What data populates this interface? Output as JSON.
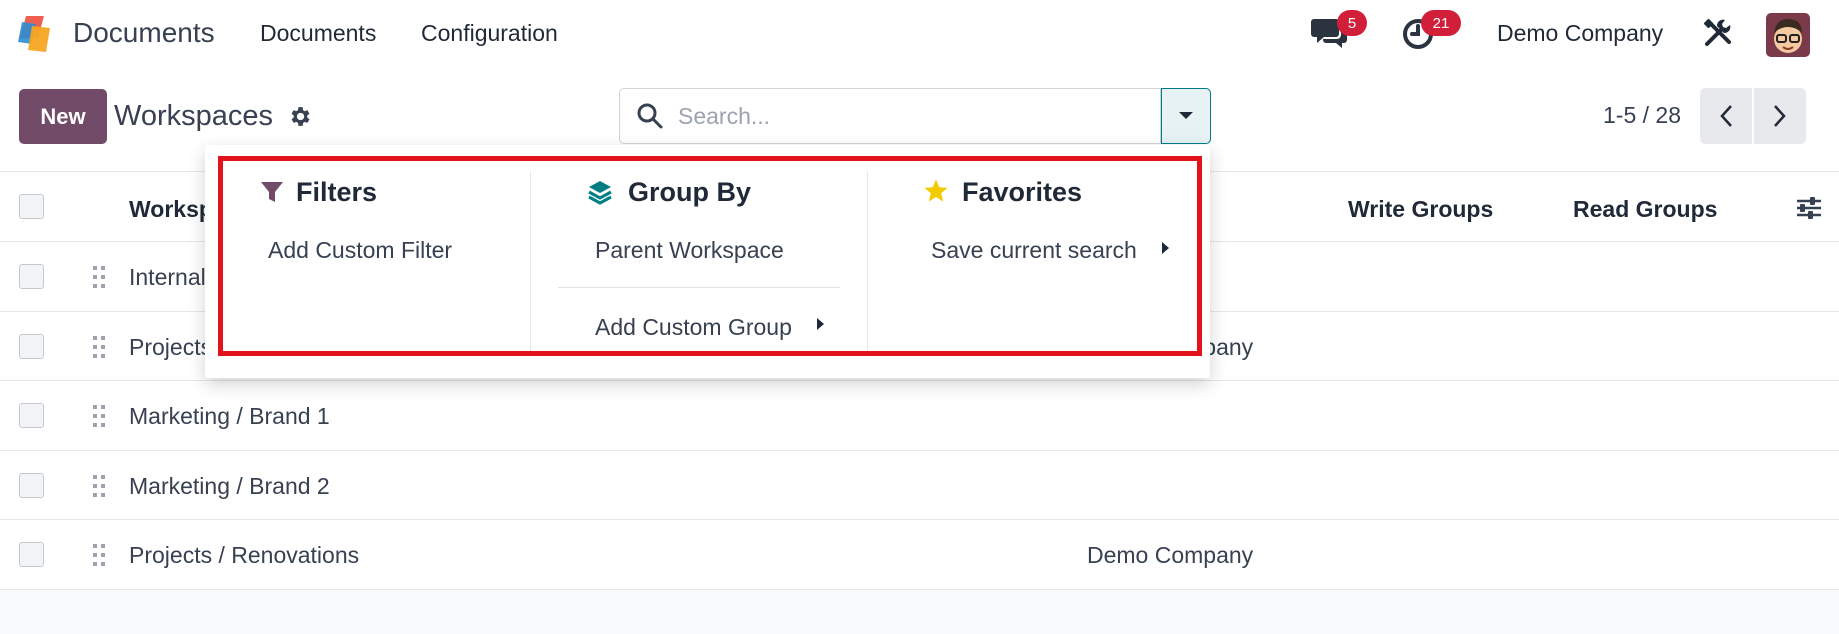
{
  "app": {
    "name": "Documents"
  },
  "navbar": {
    "menus": [
      "Documents",
      "Configuration"
    ],
    "messages_badge": "5",
    "activities_badge": "21",
    "company": "Demo Company"
  },
  "control_panel": {
    "new_label": "New",
    "title": "Workspaces",
    "search_placeholder": "Search...",
    "pager": "1-5 / 28"
  },
  "table": {
    "columns": {
      "name": "Workspace",
      "write_groups": "Write Groups",
      "read_groups": "Read Groups"
    },
    "rows": [
      {
        "name": "Internal",
        "company": ""
      },
      {
        "name": "Projects",
        "company": "Demo Company"
      },
      {
        "name": "Marketing / Brand 1",
        "company": ""
      },
      {
        "name": "Marketing / Brand 2",
        "company": ""
      },
      {
        "name": "Projects / Renovations",
        "company": "Demo Company"
      }
    ]
  },
  "search_dropdown": {
    "filters": {
      "title": "Filters",
      "items": [
        "Add Custom Filter"
      ]
    },
    "group_by": {
      "title": "Group By",
      "items": [
        "Parent Workspace"
      ],
      "custom": "Add Custom Group"
    },
    "favorites": {
      "title": "Favorites",
      "items": [
        "Save current search"
      ]
    }
  },
  "colors": {
    "primary": "#714b67",
    "teal": "#017e84",
    "badge": "#d11f3a",
    "highlight": "#e3131b",
    "star": "#f3cc00"
  },
  "icons": [
    "app-logo",
    "chat-icon",
    "clock-icon",
    "tools-icon",
    "gear-icon",
    "search-icon",
    "caret-down-icon",
    "chevron-left-icon",
    "chevron-right-icon",
    "filter-icon",
    "layers-icon",
    "star-icon",
    "drag-handle-icon",
    "column-settings-icon"
  ]
}
